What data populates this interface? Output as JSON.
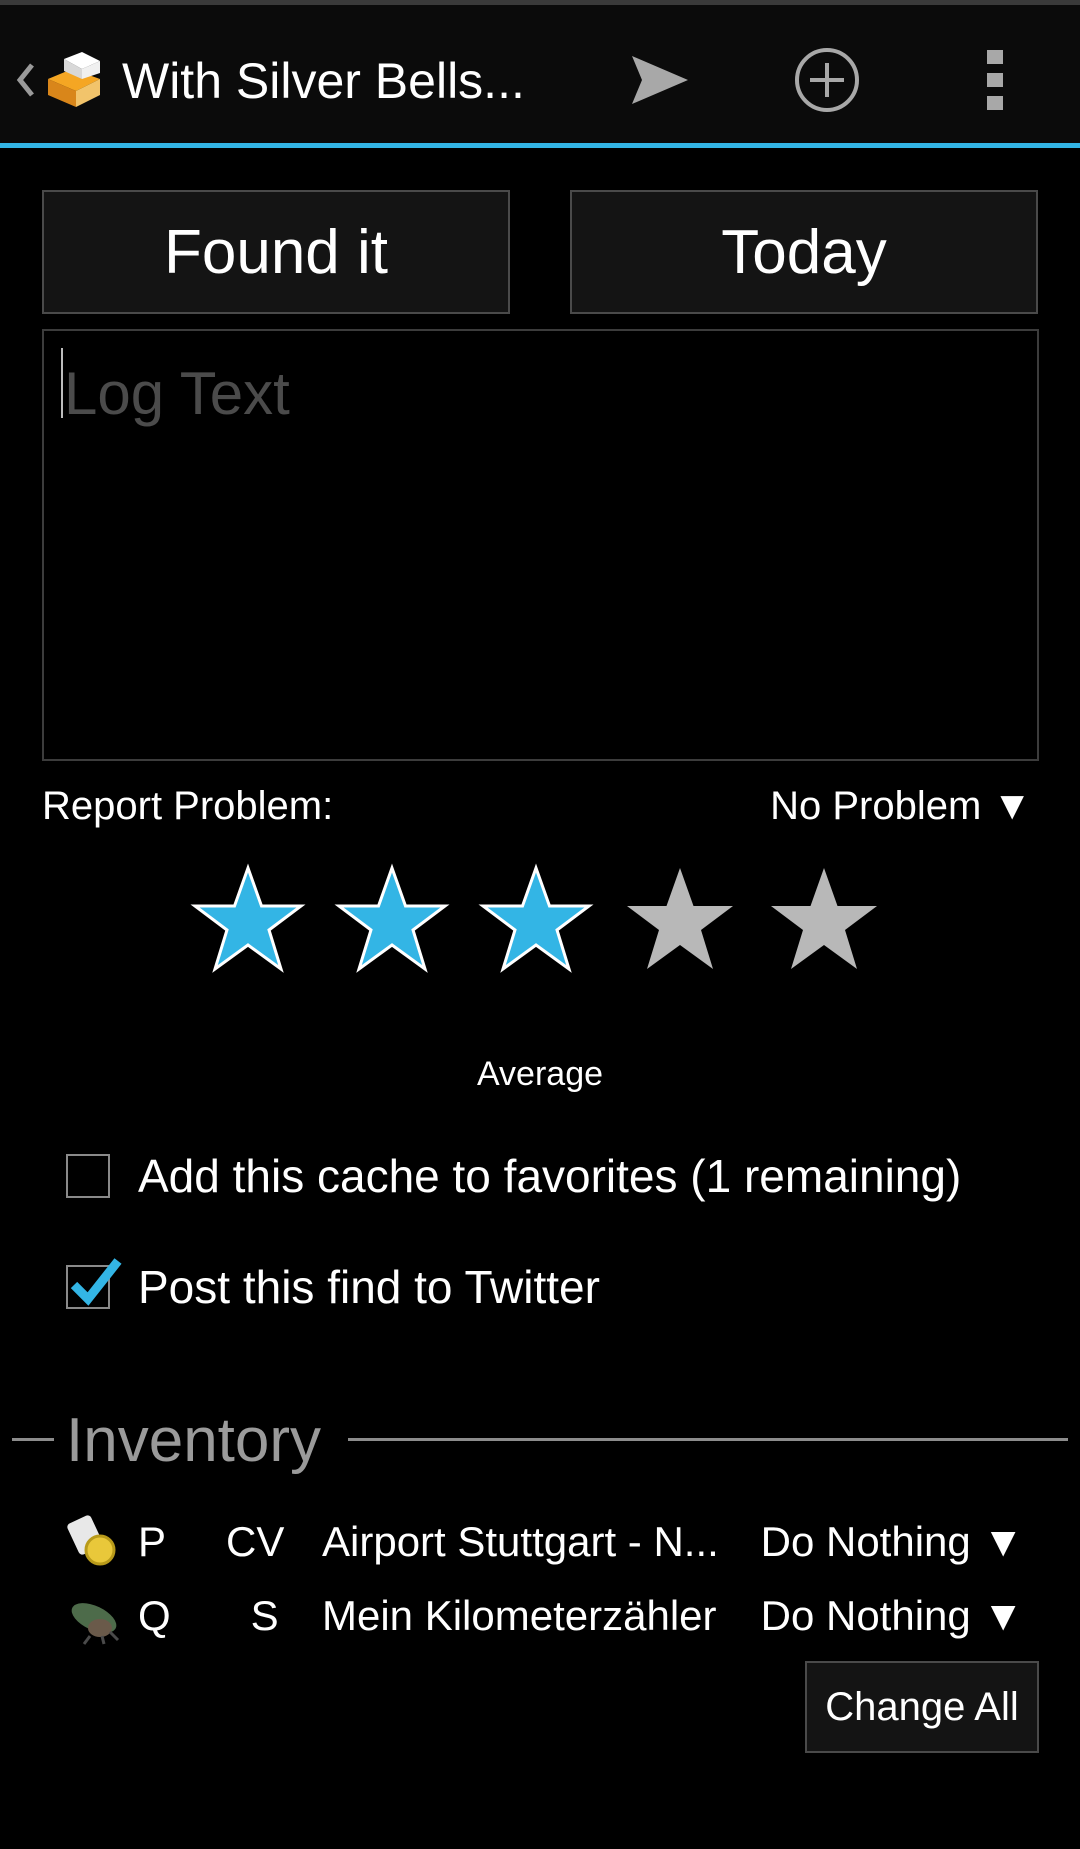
{
  "actionbar": {
    "title": "With Silver Bells...",
    "up_icon": "chevron-left-icon",
    "app_icon": "cache-app-icon",
    "send_icon": "send-icon",
    "add_icon": "add-circle-icon",
    "overflow_icon": "overflow-menu-icon",
    "accent_color": "#33b5e5"
  },
  "log": {
    "type_label": "Found it",
    "date_label": "Today",
    "text_placeholder": "Log Text",
    "text_value": ""
  },
  "report": {
    "label": "Report Problem:",
    "selected": "No Problem",
    "dropdown_arrow": "▼"
  },
  "rating": {
    "value": 3,
    "max": 5,
    "label": "Average",
    "filled_color": "#33b5e5",
    "empty_color": "#b8b8b8"
  },
  "favorites": {
    "label": "Add this cache to favorites (1 remaining)",
    "checked": false
  },
  "twitter": {
    "label": "Post this find to Twitter",
    "checked": true
  },
  "inventory": {
    "title": "Inventory",
    "items": [
      {
        "code_start": "P",
        "code_end": "CV",
        "name": "Airport Stuttgart - N...",
        "action": "Do Nothing ▼",
        "icon": "trackable-coin-icon"
      },
      {
        "code_start": "Q",
        "code_end": "S",
        "name": "Mein Kilometerzähler",
        "action": "Do Nothing ▼",
        "icon": "trackable-travelbug-icon"
      }
    ],
    "change_all_label": "Change All"
  }
}
